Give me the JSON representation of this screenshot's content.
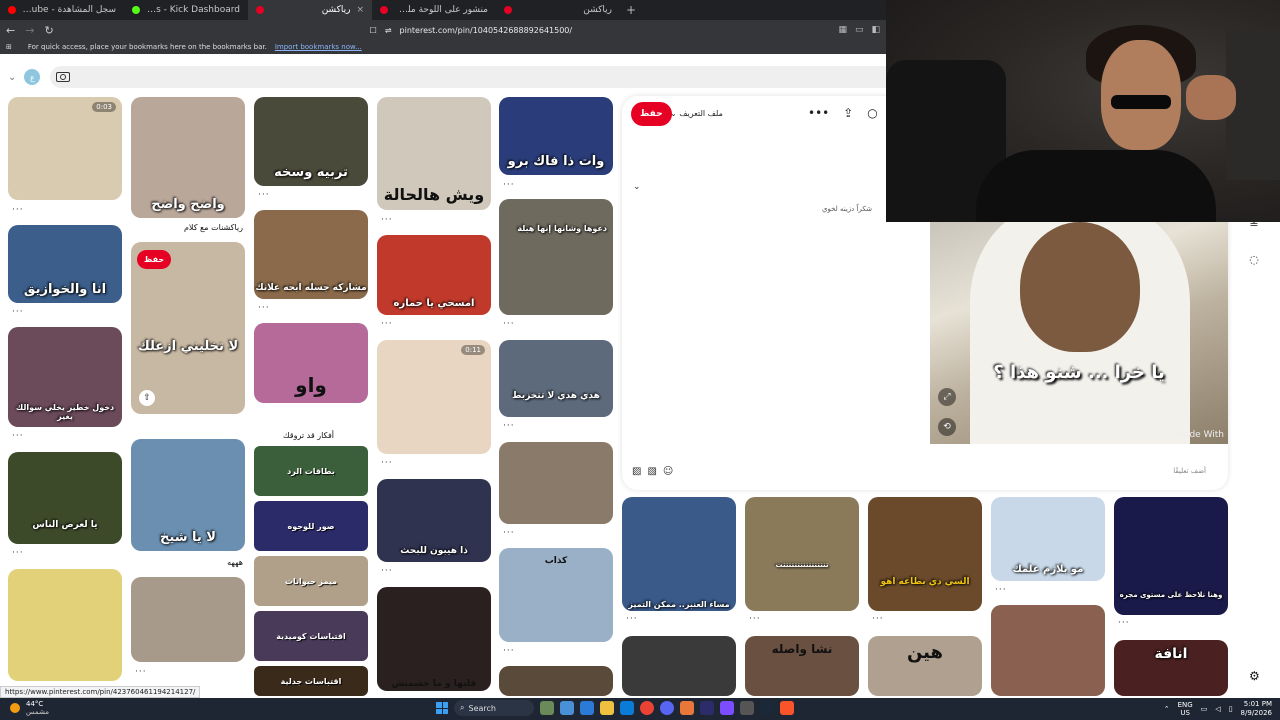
{
  "browser": {
    "tabs": [
      {
        "title": "سجل المشاهدة - YouTube",
        "fav": "#ff0000",
        "active": false
      },
      {
        "title": "Emotes - Kick Dashboard",
        "fav": "#53fc18",
        "active": false
      },
      {
        "title": "رياكشن",
        "fav": "#e60023",
        "active": true
      },
      {
        "title": "منشور على اللوحة ملصقات",
        "fav": "#e60023",
        "active": false
      },
      {
        "title": "رياكشن",
        "fav": "#e60023",
        "active": false
      }
    ],
    "new_tab": "+",
    "tab_close": "×",
    "url": "pinterest.com/pin/1040542688892641500/",
    "bookmarks_text": "For quick access, place your bookmarks here on the bookmarks bar.",
    "bookmarks_link": "Import bookmarks now...",
    "status_url": "https://www.pinterest.com/pin/423760461194214127/"
  },
  "header": {
    "avatar_letter": "ع"
  },
  "pins": [
    {
      "caption": "",
      "badge": "0:03",
      "color": "#d9cbb0"
    },
    {
      "caption": "واضح واضح",
      "color": "#b9a79a"
    },
    {
      "caption": "تربيه وسخه",
      "color": "#4a4a3a"
    },
    {
      "caption": "ويش هالحالة",
      "color": "#cfc8bb"
    },
    {
      "caption": "وات ذا فاك برو",
      "color": "#2a3d7a"
    },
    {
      "caption": "انا والخوازيق",
      "color": "#3b5f8a"
    },
    {
      "caption": "لا تخليني ازعلك",
      "color": "#c7b8a3"
    },
    {
      "caption": "مشاركه جسله ابحه علانك",
      "color": "#8a6a4a"
    },
    {
      "caption": "امسحي يا حماره",
      "color": "#c0392b"
    },
    {
      "caption": "دعوها وشانها إنها هبلة",
      "color": "#6e6a5e"
    },
    {
      "caption": "دخول خطير يخلي سوالك يغير",
      "color": "#6b4a5a"
    },
    {
      "caption": "واو",
      "color": "#b56a9a"
    },
    {
      "caption": "",
      "badge": "0:11",
      "color": "#e8d6c2"
    },
    {
      "caption": "هدي هدي لا تتخزبط",
      "color": "#5d6a7b"
    },
    {
      "caption": "يا لعرص الناس",
      "color": "#3d4a2a"
    },
    {
      "caption": "لا يا شيخ",
      "color": "#6a8fb0"
    },
    {
      "caption": "ذا هيبون للبحث",
      "color": "#2f3350"
    },
    {
      "caption": "",
      "color": "#a89a8a"
    },
    {
      "caption": "",
      "color": "#e3d17a"
    },
    {
      "caption": "",
      "color": "#8a7a6a"
    },
    {
      "caption": "كذاب",
      "color": "#9ab0c7"
    },
    {
      "caption": "قلتها و ما حشمتش",
      "color": "#2a2020"
    },
    {
      "caption": "",
      "color": "#5a4a3a"
    }
  ],
  "pin_labels": {
    "reactions_text": "رياكشنات مع كلام",
    "ideas": "أفكار قد تروقك",
    "hhhh": "هههه"
  },
  "boards": [
    {
      "label": "بطاقات الرد",
      "color": "#3b5e3b"
    },
    {
      "label": "صور للوجوه",
      "color": "#2b2b6a"
    },
    {
      "label": "ميمز حيوانات",
      "color": "#b0a08a"
    },
    {
      "label": "اقتباسات كوميدية",
      "color": "#4a3a5a"
    },
    {
      "label": "اقتباسات جدلية",
      "color": "#3a2a1a"
    }
  ],
  "detail": {
    "save_label": "حفظ",
    "profile_label": "ملف التعريف",
    "thanks_text": "شكراً دزينه لخوي",
    "image_caption": "يا خرا ... شنو هذا ؟",
    "watermark": "Made With",
    "comment_placeholder": "أضف تعليقًا"
  },
  "related": [
    {
      "caption": "مساء العنبر.. ممكن التميز",
      "color": "#3a5a8a"
    },
    {
      "caption": "تتتتتتتتتتتتتتتتت",
      "color": "#8a7a5a"
    },
    {
      "caption": "السي دي بطاعه اهو",
      "color": "#6a4a2a"
    },
    {
      "caption": "مو بلازم علمك",
      "color": "#c8d8e8"
    },
    {
      "caption": "وهنا نلاحظ على مستوى مجره",
      "color": "#1a1a4a"
    },
    {
      "caption": "",
      "color": "#3a3a3a"
    },
    {
      "caption": "نشا واصله",
      "color": "#6a5040"
    },
    {
      "caption": "هين",
      "color": "#b0a090"
    },
    {
      "caption": "",
      "color": "#8a6050"
    },
    {
      "caption": "انافة",
      "color": "#4a2020"
    }
  ],
  "taskbar": {
    "temp": "44°C",
    "weather_note": "مشمس",
    "search_label": "Search",
    "lang": "ENG",
    "region": "US",
    "time": "5:01 PM",
    "date": "8/9/2026"
  }
}
